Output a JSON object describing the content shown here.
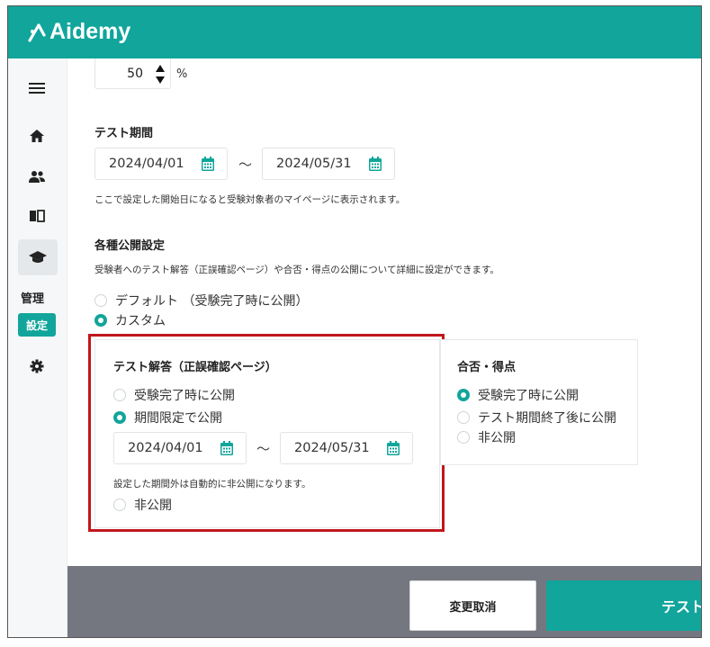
{
  "app": {
    "brand": "Aidemy"
  },
  "sidebar": {
    "icons": [
      "menu-icon",
      "home-icon",
      "users-icon",
      "book-icon",
      "graduation-cap-icon",
      "gear-icon"
    ],
    "admin_label": "管理",
    "settings_badge": "設定"
  },
  "percent": {
    "value": "50",
    "unit": "%"
  },
  "test_period": {
    "title": "テスト期間",
    "start": "2024/04/01",
    "end": "2024/05/31",
    "separator": "〜",
    "note": "ここで設定した開始日になると受験対象者のマイページに表示されます。"
  },
  "publish_settings": {
    "title": "各種公開設定",
    "description": "受験者へのテスト解答（正誤確認ページ）や合否・得点の公開について詳細に設定ができます。",
    "options": [
      {
        "label": "デフォルト （受験完了時に公開）",
        "selected": false
      },
      {
        "label": "カスタム",
        "selected": true
      }
    ]
  },
  "answer_panel": {
    "title": "テスト解答（正誤確認ページ）",
    "options": [
      {
        "label": "受験完了時に公開",
        "selected": false
      },
      {
        "label": "期間限定で公開",
        "selected": true
      },
      {
        "label": "非公開",
        "selected": false
      }
    ],
    "start": "2024/04/01",
    "end": "2024/05/31",
    "separator": "〜",
    "note": "設定した期間外は自動的に非公開になります。"
  },
  "score_panel": {
    "title": "合否・得点",
    "options": [
      {
        "label": "受験完了時に公開",
        "selected": true
      },
      {
        "label": "テスト期間終了後に公開",
        "selected": false
      },
      {
        "label": "非公開",
        "selected": false
      }
    ]
  },
  "footer": {
    "cancel_label": "変更取消",
    "test_label": "テスト"
  },
  "colors": {
    "accent": "#11a59b",
    "highlight": "#c0171c",
    "footer": "#757780"
  }
}
